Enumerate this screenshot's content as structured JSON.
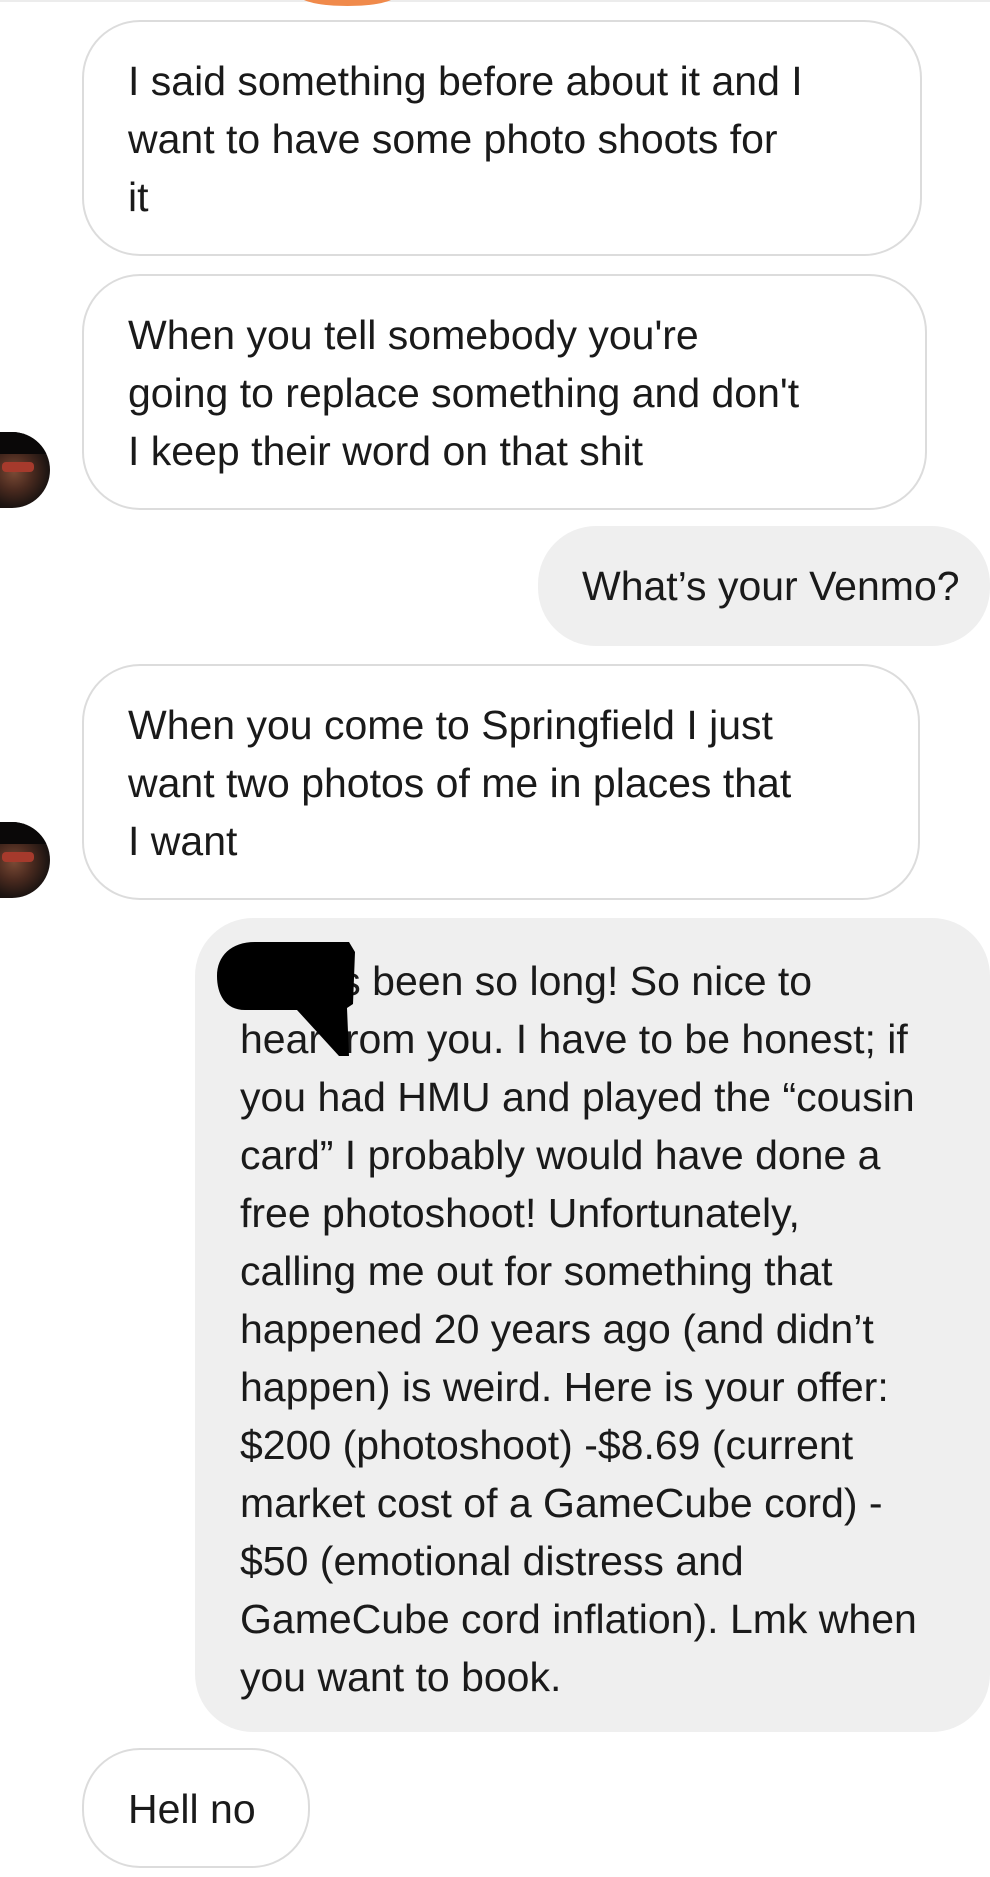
{
  "messages": [
    {
      "from": "them",
      "text": "I said something before about it and I\nwant to have some photo shoots for\nit"
    },
    {
      "from": "them",
      "text": "When you tell somebody you're\ngoing to replace something and don't\nI keep their word on that shit"
    },
    {
      "from": "me",
      "text": "What’s your Venmo?"
    },
    {
      "from": "them",
      "text": "When you come to Springfield I just\nwant two photos of me in places that\nI want"
    },
    {
      "from": "me",
      "text": "        , it has been so long! So nice to\nhear from you. I have to be honest; if\nyou had HMU and played the “cousin\ncard” I probably would have done a\nfree photoshoot! Unfortunately,\ncalling me out for something that\nhappened 20 years ago (and didn’t\nhappen) is weird. Here is your offer:\n$200 (photoshoot) -$8.69 (current\nmarket cost of a GameCube cord) -\n$50 (emotional distress and\nGameCube cord inflation). Lmk when\nyou want to book."
    },
    {
      "from": "them",
      "text": "Hell no"
    }
  ],
  "colors": {
    "incoming_bubble_bg": "#ffffff",
    "incoming_bubble_border": "#dcdcdc",
    "outgoing_bubble_bg": "#efefef",
    "text": "#1a1a1a",
    "accent": "#f08a4b"
  },
  "icons": {
    "avatar": "contact-avatar",
    "redaction": "redaction-mark"
  }
}
